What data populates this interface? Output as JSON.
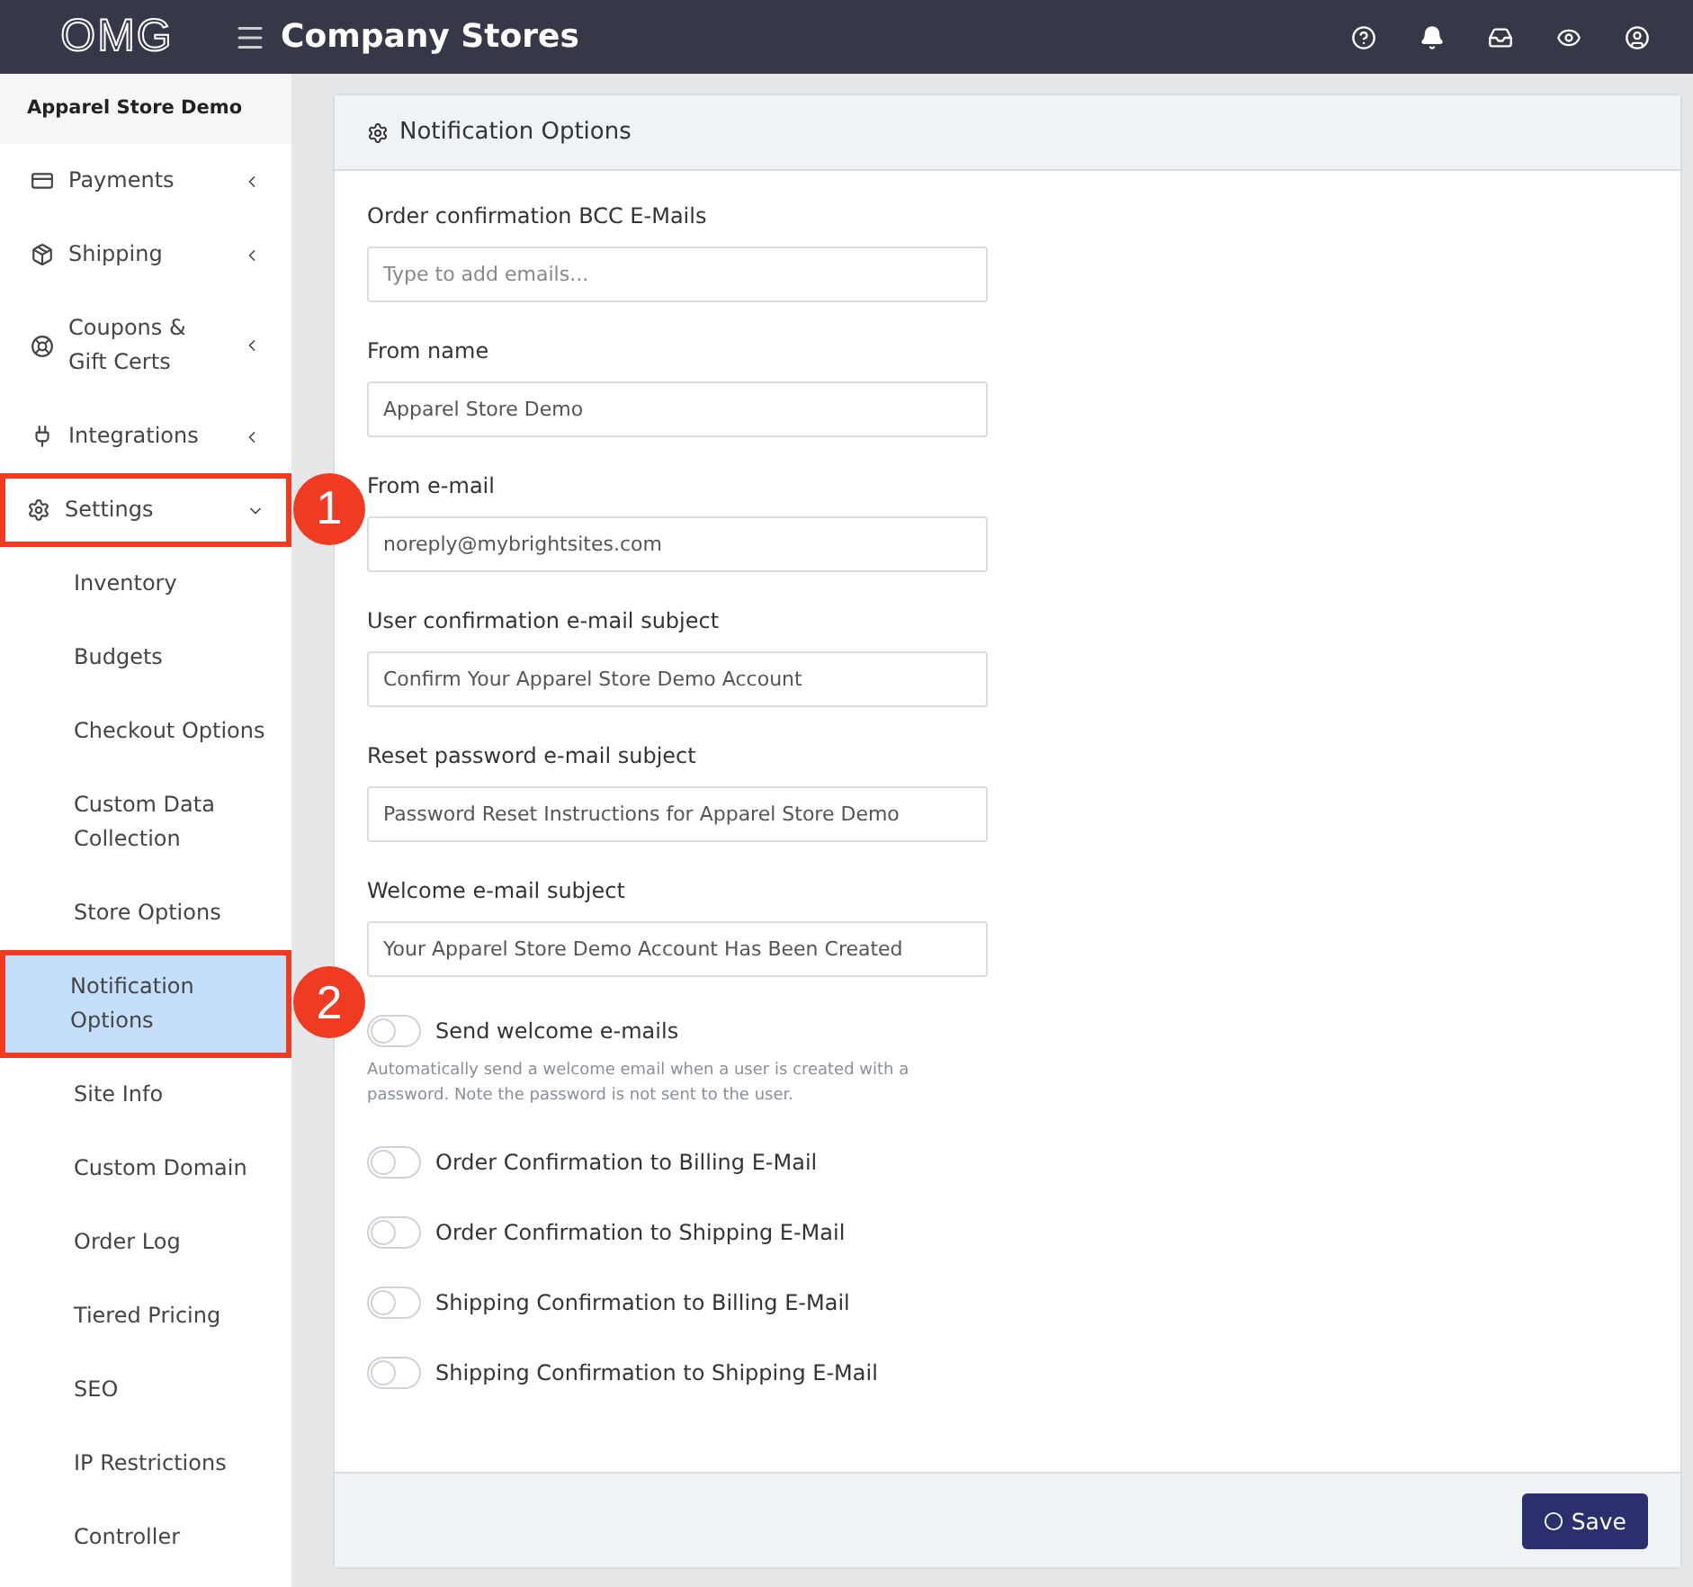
{
  "topbar": {
    "logo": "OMG",
    "title": "Company Stores"
  },
  "sidebar": {
    "store": "Apparel Store Demo",
    "items": [
      {
        "label": "Payments",
        "expanded": false,
        "selected": false
      },
      {
        "label": "Shipping",
        "expanded": false,
        "selected": false
      },
      {
        "label": "Coupons & Gift Certs",
        "expanded": false,
        "selected": false
      },
      {
        "label": "Integrations",
        "expanded": false,
        "selected": false
      },
      {
        "label": "Settings",
        "expanded": true,
        "selected": false,
        "callout": "1",
        "children": [
          {
            "label": "Inventory",
            "selected": false
          },
          {
            "label": "Budgets",
            "selected": false
          },
          {
            "label": "Checkout Options",
            "selected": false
          },
          {
            "label": "Custom Data Collection",
            "selected": false
          },
          {
            "label": "Store Options",
            "selected": false
          },
          {
            "label": "Notification Options",
            "selected": true,
            "callout": "2"
          },
          {
            "label": "Site Info",
            "selected": false
          },
          {
            "label": "Custom Domain",
            "selected": false
          },
          {
            "label": "Order Log",
            "selected": false
          },
          {
            "label": "Tiered Pricing",
            "selected": false
          },
          {
            "label": "SEO",
            "selected": false
          },
          {
            "label": "IP Restrictions",
            "selected": false
          },
          {
            "label": "Controller",
            "selected": false
          }
        ]
      }
    ]
  },
  "panel": {
    "title": "Notification Options",
    "fields": [
      {
        "label": "Order confirmation BCC E-Mails",
        "placeholder": "Type to add emails..."
      },
      {
        "label": "From name",
        "value": "Apparel Store Demo"
      },
      {
        "label": "From e-mail",
        "value": "noreply@mybrightsites.com"
      },
      {
        "label": "User confirmation e-mail subject",
        "value": "Confirm Your Apparel Store Demo Account"
      },
      {
        "label": "Reset password e-mail subject",
        "value": "Password Reset Instructions for Apparel Store Demo"
      },
      {
        "label": "Welcome e-mail subject",
        "value": "Your Apparel Store Demo Account Has Been Created"
      }
    ],
    "toggles": [
      {
        "label": "Send welcome e-mails",
        "on": false,
        "help": "Automatically send a welcome email when a user is created with a password. Note the password is not sent to the user."
      },
      {
        "label": "Order Confirmation to Billing E-Mail",
        "on": false
      },
      {
        "label": "Order Confirmation to Shipping E-Mail",
        "on": false
      },
      {
        "label": "Shipping Confirmation to Billing E-Mail",
        "on": false
      },
      {
        "label": "Shipping Confirmation to Shipping E-Mail",
        "on": false
      }
    ],
    "save": "Save"
  }
}
